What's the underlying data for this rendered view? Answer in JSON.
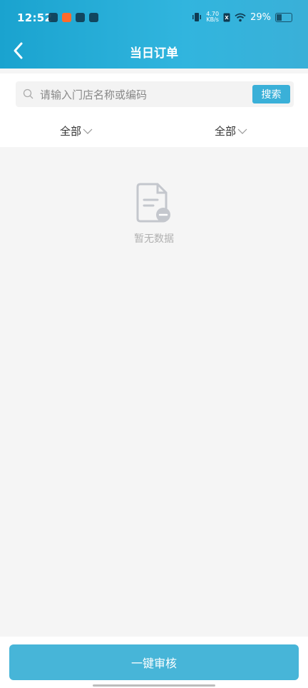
{
  "status_bar": {
    "time": "12:52",
    "net_speed_value": "4.70",
    "net_speed_unit": "KB/s",
    "battery": "29%"
  },
  "header": {
    "title": "当日订单"
  },
  "search": {
    "placeholder": "请输入门店名称或编码",
    "button_label": "搜索"
  },
  "filters": {
    "left_label": "全部",
    "right_label": "全部"
  },
  "empty_state": {
    "text": "暂无数据"
  },
  "footer": {
    "approve_label": "一键审核"
  },
  "colors": {
    "accent": "#3ab0d8",
    "header_gradient_start": "#1aa3cf"
  }
}
